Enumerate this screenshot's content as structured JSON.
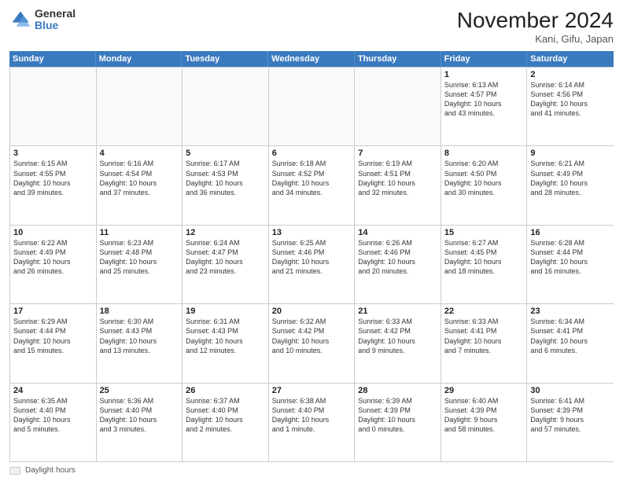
{
  "logo": {
    "general": "General",
    "blue": "Blue"
  },
  "title": "November 2024",
  "location": "Kani, Gifu, Japan",
  "days_of_week": [
    "Sunday",
    "Monday",
    "Tuesday",
    "Wednesday",
    "Thursday",
    "Friday",
    "Saturday"
  ],
  "legend": {
    "box_label": "Daylight hours"
  },
  "weeks": [
    [
      {
        "day": "",
        "info": ""
      },
      {
        "day": "",
        "info": ""
      },
      {
        "day": "",
        "info": ""
      },
      {
        "day": "",
        "info": ""
      },
      {
        "day": "",
        "info": ""
      },
      {
        "day": "1",
        "info": "Sunrise: 6:13 AM\nSunset: 4:57 PM\nDaylight: 10 hours\nand 43 minutes."
      },
      {
        "day": "2",
        "info": "Sunrise: 6:14 AM\nSunset: 4:56 PM\nDaylight: 10 hours\nand 41 minutes."
      }
    ],
    [
      {
        "day": "3",
        "info": "Sunrise: 6:15 AM\nSunset: 4:55 PM\nDaylight: 10 hours\nand 39 minutes."
      },
      {
        "day": "4",
        "info": "Sunrise: 6:16 AM\nSunset: 4:54 PM\nDaylight: 10 hours\nand 37 minutes."
      },
      {
        "day": "5",
        "info": "Sunrise: 6:17 AM\nSunset: 4:53 PM\nDaylight: 10 hours\nand 36 minutes."
      },
      {
        "day": "6",
        "info": "Sunrise: 6:18 AM\nSunset: 4:52 PM\nDaylight: 10 hours\nand 34 minutes."
      },
      {
        "day": "7",
        "info": "Sunrise: 6:19 AM\nSunset: 4:51 PM\nDaylight: 10 hours\nand 32 minutes."
      },
      {
        "day": "8",
        "info": "Sunrise: 6:20 AM\nSunset: 4:50 PM\nDaylight: 10 hours\nand 30 minutes."
      },
      {
        "day": "9",
        "info": "Sunrise: 6:21 AM\nSunset: 4:49 PM\nDaylight: 10 hours\nand 28 minutes."
      }
    ],
    [
      {
        "day": "10",
        "info": "Sunrise: 6:22 AM\nSunset: 4:49 PM\nDaylight: 10 hours\nand 26 minutes."
      },
      {
        "day": "11",
        "info": "Sunrise: 6:23 AM\nSunset: 4:48 PM\nDaylight: 10 hours\nand 25 minutes."
      },
      {
        "day": "12",
        "info": "Sunrise: 6:24 AM\nSunset: 4:47 PM\nDaylight: 10 hours\nand 23 minutes."
      },
      {
        "day": "13",
        "info": "Sunrise: 6:25 AM\nSunset: 4:46 PM\nDaylight: 10 hours\nand 21 minutes."
      },
      {
        "day": "14",
        "info": "Sunrise: 6:26 AM\nSunset: 4:46 PM\nDaylight: 10 hours\nand 20 minutes."
      },
      {
        "day": "15",
        "info": "Sunrise: 6:27 AM\nSunset: 4:45 PM\nDaylight: 10 hours\nand 18 minutes."
      },
      {
        "day": "16",
        "info": "Sunrise: 6:28 AM\nSunset: 4:44 PM\nDaylight: 10 hours\nand 16 minutes."
      }
    ],
    [
      {
        "day": "17",
        "info": "Sunrise: 6:29 AM\nSunset: 4:44 PM\nDaylight: 10 hours\nand 15 minutes."
      },
      {
        "day": "18",
        "info": "Sunrise: 6:30 AM\nSunset: 4:43 PM\nDaylight: 10 hours\nand 13 minutes."
      },
      {
        "day": "19",
        "info": "Sunrise: 6:31 AM\nSunset: 4:43 PM\nDaylight: 10 hours\nand 12 minutes."
      },
      {
        "day": "20",
        "info": "Sunrise: 6:32 AM\nSunset: 4:42 PM\nDaylight: 10 hours\nand 10 minutes."
      },
      {
        "day": "21",
        "info": "Sunrise: 6:33 AM\nSunset: 4:42 PM\nDaylight: 10 hours\nand 9 minutes."
      },
      {
        "day": "22",
        "info": "Sunrise: 6:33 AM\nSunset: 4:41 PM\nDaylight: 10 hours\nand 7 minutes."
      },
      {
        "day": "23",
        "info": "Sunrise: 6:34 AM\nSunset: 4:41 PM\nDaylight: 10 hours\nand 6 minutes."
      }
    ],
    [
      {
        "day": "24",
        "info": "Sunrise: 6:35 AM\nSunset: 4:40 PM\nDaylight: 10 hours\nand 5 minutes."
      },
      {
        "day": "25",
        "info": "Sunrise: 6:36 AM\nSunset: 4:40 PM\nDaylight: 10 hours\nand 3 minutes."
      },
      {
        "day": "26",
        "info": "Sunrise: 6:37 AM\nSunset: 4:40 PM\nDaylight: 10 hours\nand 2 minutes."
      },
      {
        "day": "27",
        "info": "Sunrise: 6:38 AM\nSunset: 4:40 PM\nDaylight: 10 hours\nand 1 minute."
      },
      {
        "day": "28",
        "info": "Sunrise: 6:39 AM\nSunset: 4:39 PM\nDaylight: 10 hours\nand 0 minutes."
      },
      {
        "day": "29",
        "info": "Sunrise: 6:40 AM\nSunset: 4:39 PM\nDaylight: 9 hours\nand 58 minutes."
      },
      {
        "day": "30",
        "info": "Sunrise: 6:41 AM\nSunset: 4:39 PM\nDaylight: 9 hours\nand 57 minutes."
      }
    ]
  ]
}
